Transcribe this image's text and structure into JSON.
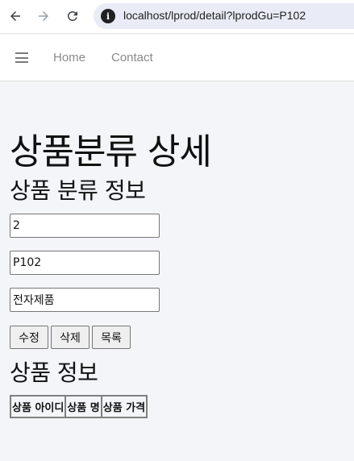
{
  "browser": {
    "url": "localhost/lprod/detail?lprodGu=P102",
    "icons": [
      "back-arrow-icon",
      "forward-arrow-icon",
      "reload-icon",
      "site-info-icon"
    ]
  },
  "navbar": {
    "menu_icon": "hamburger-menu-icon",
    "links": [
      {
        "label": "Home"
      },
      {
        "label": "Contact"
      }
    ]
  },
  "page": {
    "title": "상품분류 상세",
    "section_category": "상품 분류 정보",
    "fields": [
      {
        "value": "2"
      },
      {
        "value": "P102"
      },
      {
        "value": "전자제품"
      }
    ],
    "buttons": {
      "edit": "수정",
      "delete": "삭제",
      "list": "목록"
    },
    "section_products": "상품 정보",
    "table": {
      "columns": [
        "상품 아이디",
        "상품 명",
        "상품 가격"
      ],
      "rows": []
    }
  }
}
